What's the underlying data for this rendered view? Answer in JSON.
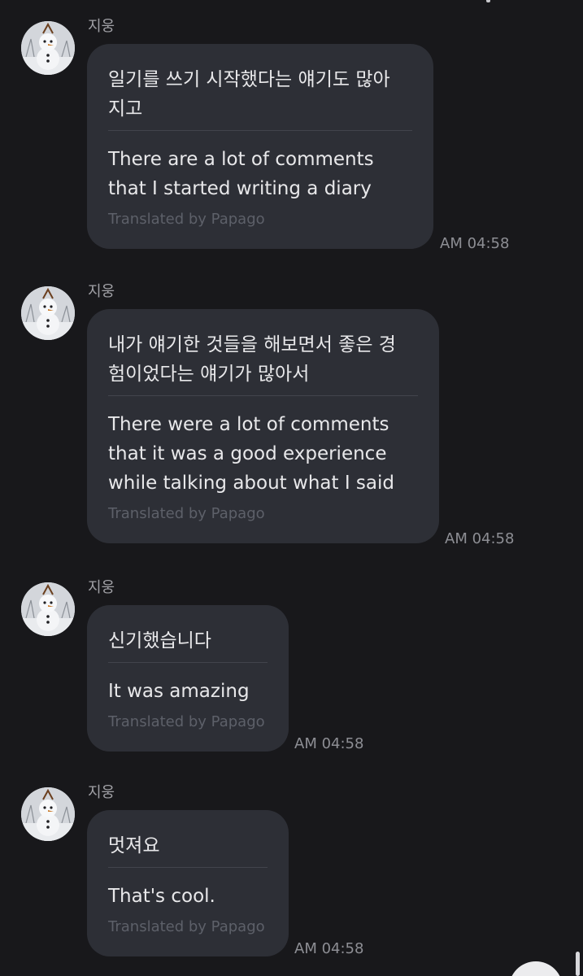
{
  "messages": [
    {
      "sender": "지웅",
      "original": "일기를 쓰기 시작했다는 얘기도 많아\n지고",
      "translation": "There are a lot of comments\nthat I started writing a diary",
      "credit": "Translated by Papago",
      "time": "AM 04:58"
    },
    {
      "sender": "지웅",
      "original": "내가 얘기한 것들을 해보면서 좋은 경\n험이었다는 얘기가 많아서",
      "translation": "There were a lot of comments\nthat it was a good experience\nwhile talking about what I said",
      "credit": "Translated by Papago",
      "time": "AM 04:58"
    },
    {
      "sender": "지웅",
      "original": "신기했습니다",
      "translation": "It was amazing",
      "credit": "Translated by Papago",
      "time": "AM 04:58"
    },
    {
      "sender": "지웅",
      "original": "멋져요",
      "translation": "That's cool.",
      "credit": "Translated by Papago",
      "time": "AM 04:58"
    }
  ],
  "colors": {
    "background": "#18181b",
    "bubble": "#2d2f36",
    "text": "#e8e8ea",
    "muted": "#8d8e94"
  }
}
